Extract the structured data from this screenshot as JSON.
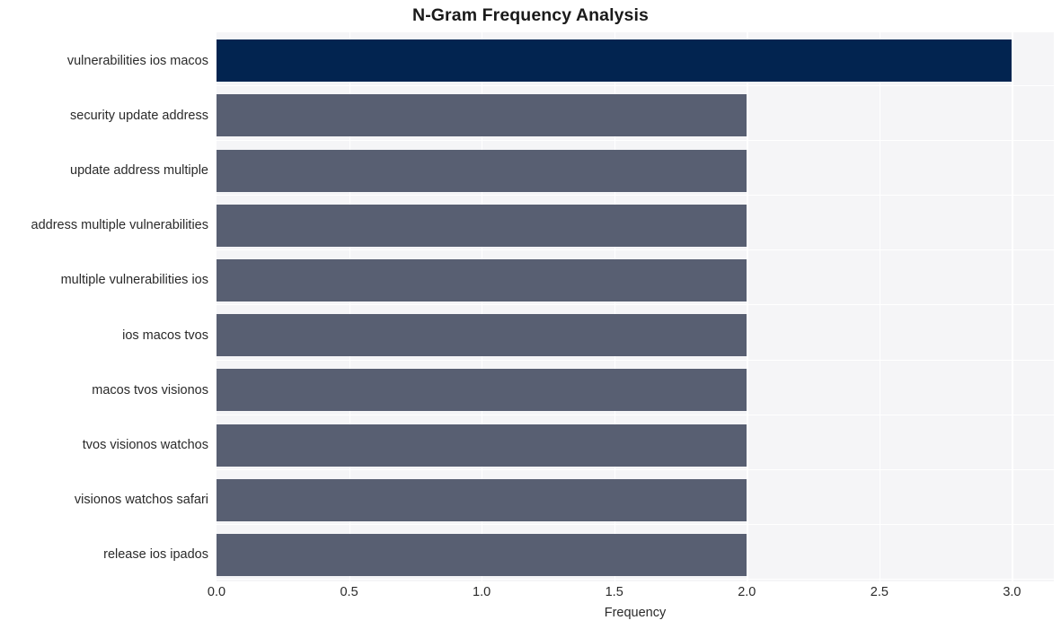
{
  "chart_data": {
    "type": "bar",
    "orientation": "horizontal",
    "title": "N-Gram Frequency Analysis",
    "xlabel": "Frequency",
    "ylabel": "",
    "categories": [
      "vulnerabilities ios macos",
      "security update address",
      "update address multiple",
      "address multiple vulnerabilities",
      "multiple vulnerabilities ios",
      "ios macos tvos",
      "macos tvos visionos",
      "tvos visionos watchos",
      "visionos watchos safari",
      "release ios ipados"
    ],
    "values": [
      3,
      2,
      2,
      2,
      2,
      2,
      2,
      2,
      2,
      2
    ],
    "bar_colors": [
      "#022450",
      "#585f72",
      "#585f72",
      "#585f72",
      "#585f72",
      "#585f72",
      "#585f72",
      "#585f72",
      "#585f72",
      "#585f72"
    ],
    "xlim": [
      0.0,
      3.1578
    ],
    "xticks": [
      0.0,
      0.5,
      1.0,
      1.5,
      2.0,
      2.5,
      3.0
    ],
    "xticklabels": [
      "0.0",
      "0.5",
      "1.0",
      "1.5",
      "2.0",
      "2.5",
      "3.0"
    ],
    "grid": true,
    "grid_color": "#ffffff",
    "plot_background": "#f5f5f7",
    "figure_background": "#ffffff",
    "legend": null,
    "legend_position": "none"
  }
}
